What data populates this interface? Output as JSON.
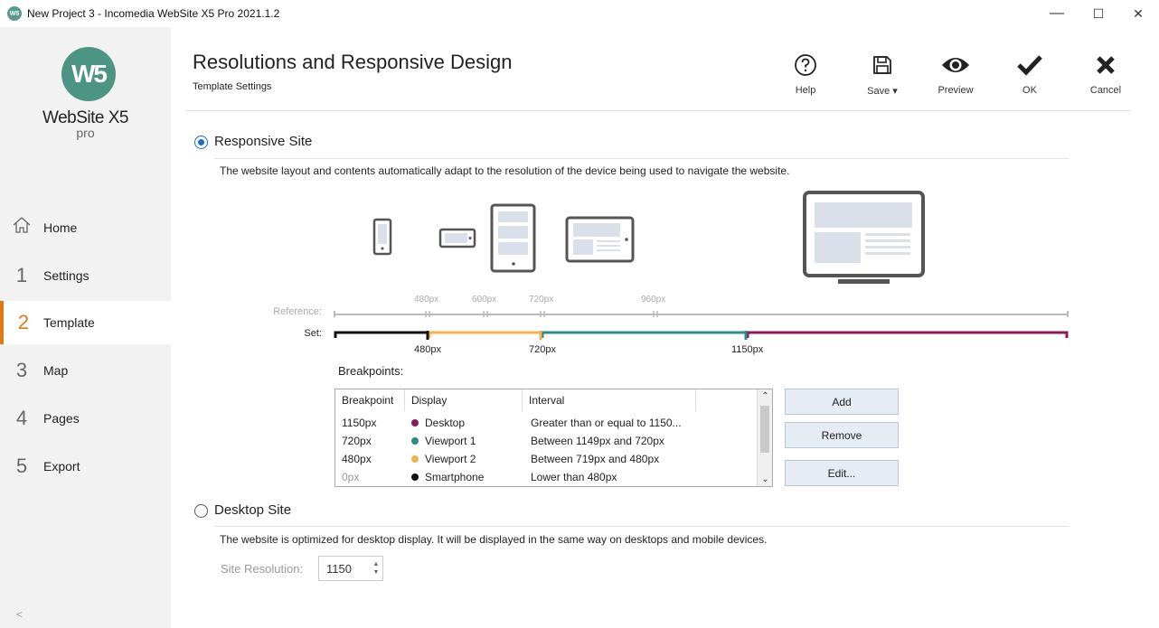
{
  "window": {
    "title": "New Project 3 - Incomedia WebSite X5 Pro 2021.1.2",
    "app_icon": "W5",
    "controls": {
      "minimize": "—",
      "maximize": "☐",
      "close": "✕"
    }
  },
  "sidebar": {
    "logo_mark": "W5",
    "logo_text": "WebSite X5",
    "logo_sub": "pro",
    "collapse_glyph": "<",
    "items": [
      {
        "num": "",
        "label": "Home",
        "icon": "home-icon"
      },
      {
        "num": "1",
        "label": "Settings"
      },
      {
        "num": "2",
        "label": "Template",
        "active": true
      },
      {
        "num": "3",
        "label": "Map"
      },
      {
        "num": "4",
        "label": "Pages"
      },
      {
        "num": "5",
        "label": "Export"
      }
    ],
    "accent_color": "#e07b14"
  },
  "header": {
    "title": "Resolutions and Responsive Design",
    "subtitle": "Template Settings",
    "toolbar": {
      "help": "Help",
      "save": "Save ▾",
      "preview": "Preview",
      "ok": "OK",
      "cancel": "Cancel"
    }
  },
  "responsive": {
    "label": "Responsive Site",
    "checked": true,
    "description": "The website layout and contents automatically adapt to the resolution of the device being used to navigate the website.",
    "reference_label": "Reference:",
    "set_label": "Set:",
    "reference_ticks": [
      "480px",
      "600px",
      "720px",
      "960px"
    ],
    "set_ticks": [
      "480px",
      "720px",
      "1150px"
    ],
    "segment_colors": {
      "smartphone": "#111111",
      "viewport2": "#f0b24a",
      "viewport1": "#2a8c8c",
      "desktop": "#8c1a5a"
    },
    "breakpoints_label": "Breakpoints:",
    "columns": [
      "Breakpoint",
      "Display",
      "Interval"
    ],
    "rows": [
      {
        "breakpoint": "1150px",
        "display": "Desktop",
        "interval": "Greater than or equal to 1150...",
        "color": "#8c1a5a"
      },
      {
        "breakpoint": "720px",
        "display": "Viewport 1",
        "interval": "Between 1149px and 720px",
        "color": "#2a8c8c"
      },
      {
        "breakpoint": "480px",
        "display": "Viewport 2",
        "interval": "Between 719px and 480px",
        "color": "#f0b24a"
      },
      {
        "breakpoint": "0px",
        "display": "Smartphone",
        "interval": "Lower than 480px",
        "color": "#111111"
      }
    ],
    "buttons": {
      "add": "Add",
      "remove": "Remove",
      "edit": "Edit..."
    }
  },
  "desktop": {
    "label": "Desktop Site",
    "checked": false,
    "description": "The website is optimized for desktop display. It will be displayed in the same way on desktops and mobile devices.",
    "resolution_label": "Site Resolution:",
    "resolution_value": "1150"
  }
}
